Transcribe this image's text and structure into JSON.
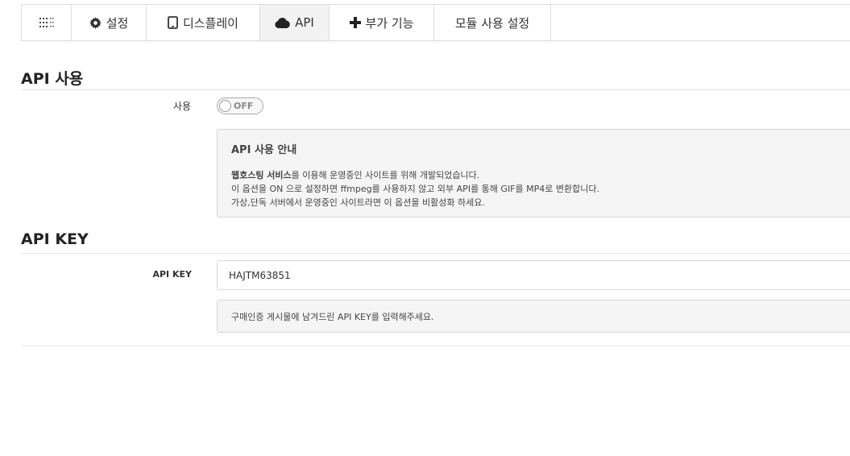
{
  "tabs": [
    {
      "label": "",
      "icon": "grid-icon"
    },
    {
      "label": "설정",
      "icon": "gear-icon"
    },
    {
      "label": "디스플레이",
      "icon": "tablet-icon"
    },
    {
      "label": "API",
      "icon": "cloud-icon",
      "active": true
    },
    {
      "label": "부가 기능",
      "icon": "plus-icon"
    },
    {
      "label": "모듈 사용 설정",
      "icon": ""
    }
  ],
  "api_use": {
    "section_title": "API 사용",
    "field_label": "사용",
    "toggle_state": "OFF",
    "info_title": "API 사용 안내",
    "info_line1_bold": "웹호스팅 서비스",
    "info_line1_rest": "를 이용해 운영중인 사이트를 위해 개발되었습니다.",
    "info_line2": "이 옵션을 ON 으로 설정하면 ffmpeg를 사용하지 않고 외부 API를 통해 GIF를 MP4로 변환합니다.",
    "info_line3": "가상,단독 서버에서 운영중인 사이트라면 이 옵션을 비활성화 하세요."
  },
  "api_key": {
    "section_title": "API KEY",
    "field_label": "API KEY",
    "value": "HAJTM63851",
    "help_text": "구매인증 게시물에 남겨드린 API KEY를 입력해주세요."
  },
  "colors": {
    "active_tab": "#f2f2f2",
    "border": "#dddddd",
    "info_bg": "#f5f5f5"
  }
}
